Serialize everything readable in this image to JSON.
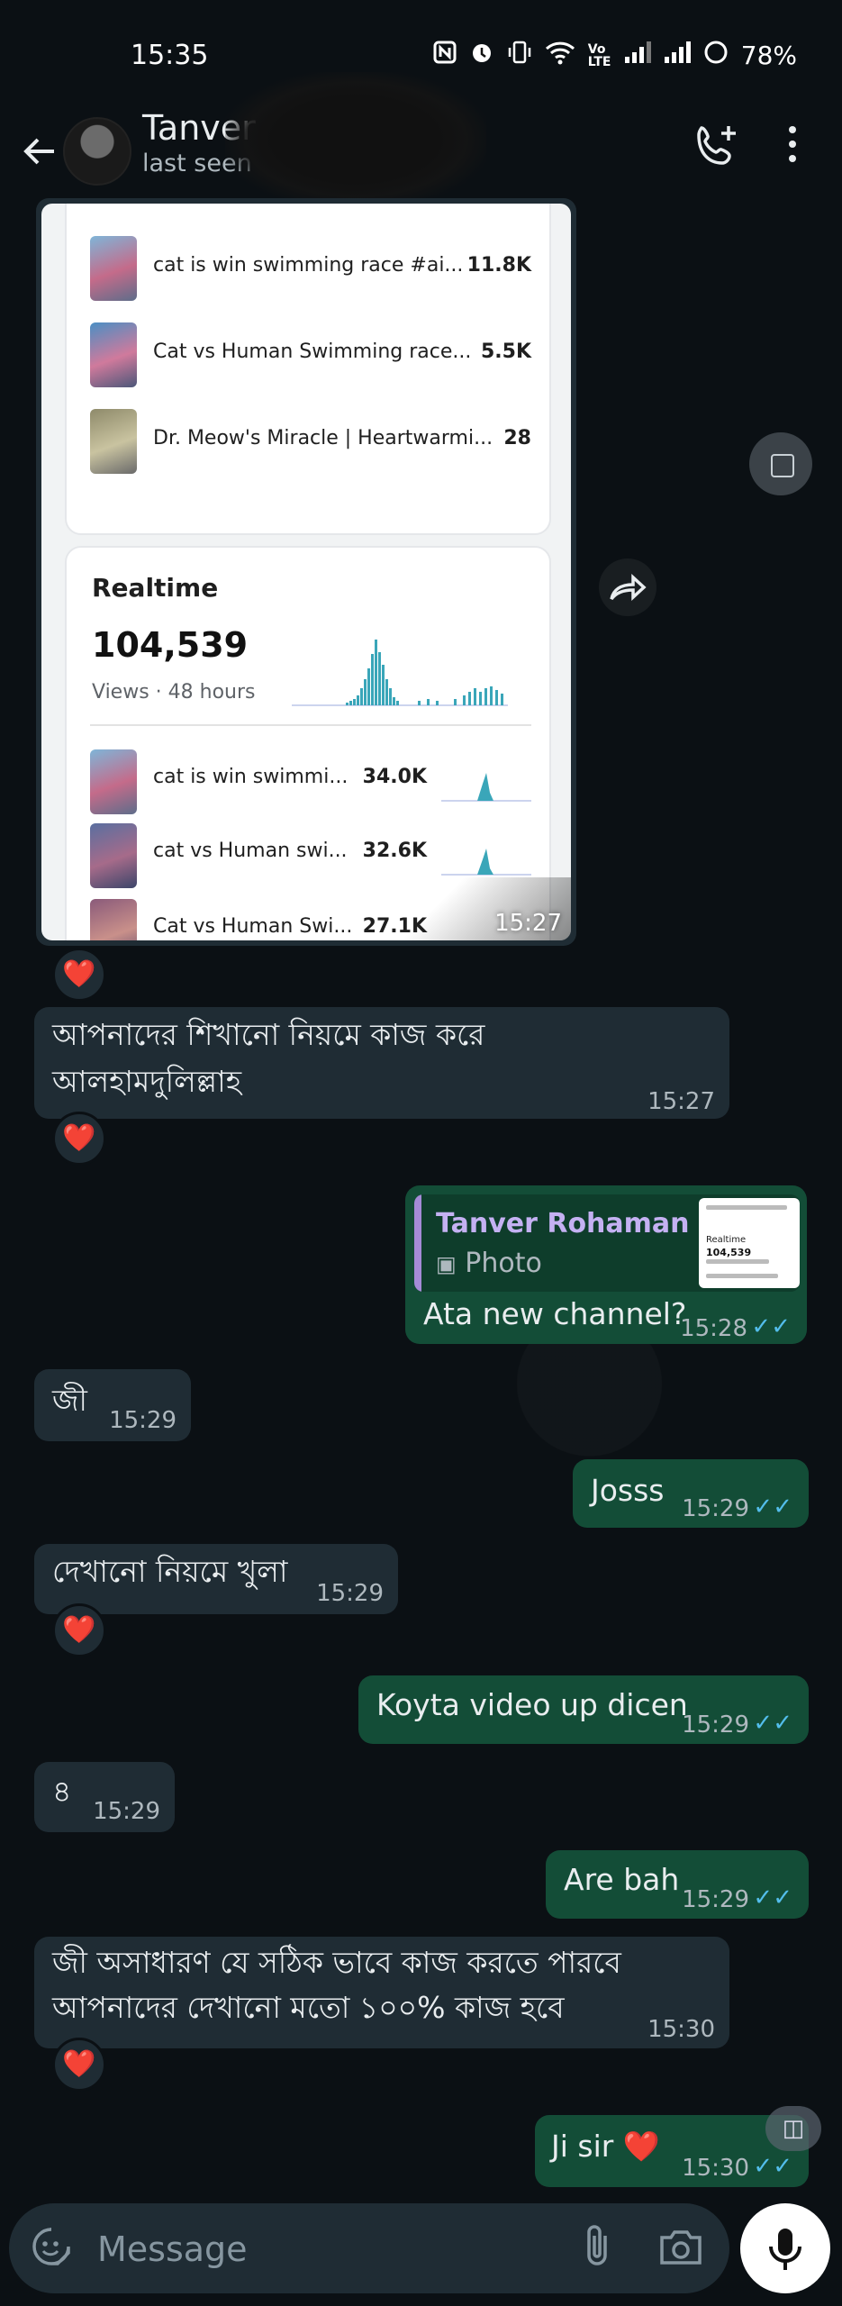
{
  "status_bar": {
    "time": "15:35",
    "icons": [
      "nfc-icon",
      "alarm-icon",
      "vibrate-icon",
      "wifi-icon",
      "volte-icon",
      "signal-icon",
      "signal-icon-2",
      "battery-icon"
    ],
    "volte_label": "Vo LTE",
    "battery": "78%"
  },
  "header": {
    "contact_name": "Tanver",
    "contact_status": "last seen"
  },
  "image_message": {
    "top_videos": [
      {
        "title": "cat is win swimming race #ai...",
        "views": "11.8K"
      },
      {
        "title": "Cat vs Human Swimming race...",
        "views": "5.5K"
      },
      {
        "title": "Dr. Meow's Miracle | Heartwarmi...",
        "views": "28"
      }
    ],
    "realtime": {
      "title": "Realtime",
      "views": "104,539",
      "label": "Views · 48 hours",
      "rows": [
        {
          "title": "cat is win swimmi...",
          "views": "34.0K"
        },
        {
          "title": "cat vs Human swi...",
          "views": "32.6K"
        },
        {
          "title": "Cat vs Human Swi...",
          "views": "27.1K"
        }
      ]
    },
    "time": "15:27",
    "reaction": "❤️"
  },
  "messages": [
    {
      "dir": "in",
      "text_lines": [
        "আপনাদের শিখানো নিয়মে কাজ করে",
        "আলহামদুলিল্লাহ"
      ],
      "time": "15:27",
      "reaction": "❤️"
    },
    {
      "dir": "out",
      "quote_name": "Tanver Rohaman",
      "quote_type": "Photo",
      "quote_thumb_text": [
        "Realtime",
        "104,539"
      ],
      "text": "Ata new channel?",
      "time": "15:28",
      "ticks": "✓✓"
    },
    {
      "dir": "in",
      "text": "জী",
      "time": "15:29"
    },
    {
      "dir": "out",
      "text": "Josss",
      "time": "15:29",
      "ticks": "✓✓"
    },
    {
      "dir": "in",
      "text": "দেখানো নিয়মে খুলা",
      "time": "15:29",
      "reaction": "❤️"
    },
    {
      "dir": "out",
      "text": "Koyta video up dicen",
      "time": "15:29",
      "ticks": "✓✓"
    },
    {
      "dir": "in",
      "text": "৪",
      "time": "15:29"
    },
    {
      "dir": "out",
      "text": "Are bah",
      "time": "15:29",
      "ticks": "✓✓"
    },
    {
      "dir": "in",
      "text_lines": [
        "জী অসাধারণ যে সঠিক ভাবে কাজ করতে পারবে",
        "আপনাদের দেখানো মতো ১০০% কাজ হবে"
      ],
      "time": "15:30",
      "reaction": "❤️"
    },
    {
      "dir": "out",
      "text": "Ji sir ❤️",
      "time": "15:30",
      "ticks": "✓✓"
    }
  ],
  "input": {
    "placeholder": "Message"
  },
  "colors": {
    "background": "#0b1014",
    "incoming_bubble": "#1f2c34",
    "outgoing_bubble": "#134d37",
    "read_ticks": "#53bdeb",
    "heart": "#e6364a"
  }
}
